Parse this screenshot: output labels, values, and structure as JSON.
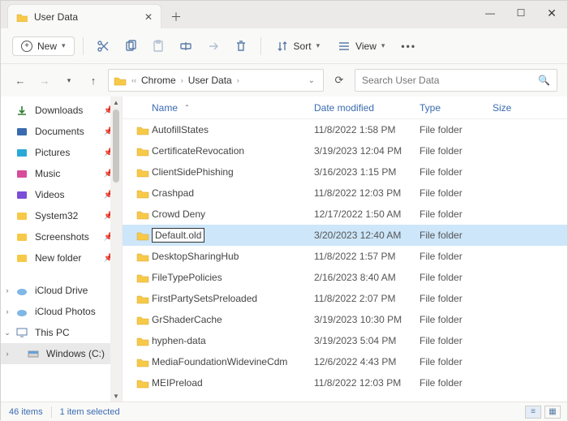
{
  "window": {
    "tab_title": "User Data"
  },
  "toolbar": {
    "new_label": "New",
    "sort_label": "Sort",
    "view_label": "View"
  },
  "address": {
    "crumbs": [
      "Chrome",
      "User Data"
    ]
  },
  "search": {
    "placeholder": "Search User Data"
  },
  "sidebar": {
    "quick": [
      {
        "label": "Downloads",
        "icon": "downloads",
        "pin": true
      },
      {
        "label": "Documents",
        "icon": "documents",
        "pin": true
      },
      {
        "label": "Pictures",
        "icon": "pictures",
        "pin": true
      },
      {
        "label": "Music",
        "icon": "music",
        "pin": true
      },
      {
        "label": "Videos",
        "icon": "videos",
        "pin": true
      },
      {
        "label": "System32",
        "icon": "folder",
        "pin": true
      },
      {
        "label": "Screenshots",
        "icon": "folder",
        "pin": true
      },
      {
        "label": "New folder",
        "icon": "folder",
        "pin": true
      }
    ],
    "drives": [
      {
        "label": "iCloud Drive",
        "icon": "icloud",
        "exp": ">"
      },
      {
        "label": "iCloud Photos",
        "icon": "iphotos",
        "exp": ">"
      },
      {
        "label": "This PC",
        "icon": "thispc",
        "exp": "v"
      },
      {
        "label": "Windows (C:)",
        "icon": "disk",
        "exp": ">",
        "indent": true,
        "selected": true
      }
    ]
  },
  "columns": {
    "name": "Name",
    "date": "Date modified",
    "type": "Type",
    "size": "Size"
  },
  "files": [
    {
      "name": "AutofillStates",
      "date": "11/8/2022 1:58 PM",
      "type": "File folder"
    },
    {
      "name": "CertificateRevocation",
      "date": "3/19/2023 12:04 PM",
      "type": "File folder"
    },
    {
      "name": "ClientSidePhishing",
      "date": "3/16/2023 1:15 PM",
      "type": "File folder"
    },
    {
      "name": "Crashpad",
      "date": "11/8/2022 12:03 PM",
      "type": "File folder"
    },
    {
      "name": "Crowd Deny",
      "date": "12/17/2022 1:50 AM",
      "type": "File folder"
    },
    {
      "name": "Default.old",
      "date": "3/20/2023 12:40 AM",
      "type": "File folder",
      "rename": true,
      "selected": true
    },
    {
      "name": "DesktopSharingHub",
      "date": "11/8/2022 1:57 PM",
      "type": "File folder"
    },
    {
      "name": "FileTypePolicies",
      "date": "2/16/2023 8:40 AM",
      "type": "File folder"
    },
    {
      "name": "FirstPartySetsPreloaded",
      "date": "11/8/2022 2:07 PM",
      "type": "File folder"
    },
    {
      "name": "GrShaderCache",
      "date": "3/19/2023 10:30 PM",
      "type": "File folder"
    },
    {
      "name": "hyphen-data",
      "date": "3/19/2023 5:04 PM",
      "type": "File folder"
    },
    {
      "name": "MediaFoundationWidevineCdm",
      "date": "12/6/2022 4:43 PM",
      "type": "File folder"
    },
    {
      "name": "MEIPreload",
      "date": "11/8/2022 12:03 PM",
      "type": "File folder"
    }
  ],
  "status": {
    "count": "46 items",
    "selection": "1 item selected"
  }
}
